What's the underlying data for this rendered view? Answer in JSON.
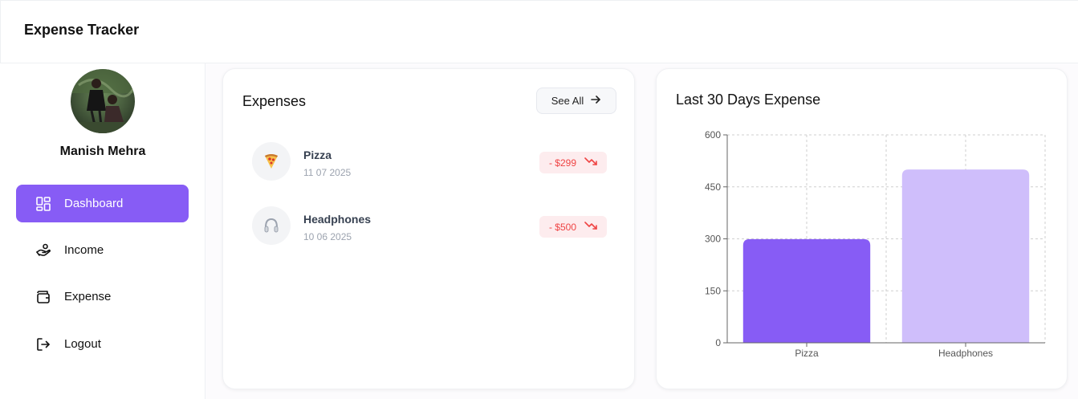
{
  "app": {
    "title": "Expense Tracker"
  },
  "sidebar": {
    "user_name": "Manish Mehra",
    "items": [
      {
        "label": "Dashboard",
        "icon": "dashboard-icon",
        "active": true
      },
      {
        "label": "Income",
        "icon": "income-hand-coins-icon",
        "active": false
      },
      {
        "label": "Expense",
        "icon": "wallet-icon",
        "active": false
      },
      {
        "label": "Logout",
        "icon": "logout-icon",
        "active": false
      }
    ]
  },
  "expenses_card": {
    "title": "Expenses",
    "see_all_label": "See All",
    "items": [
      {
        "name": "Pizza",
        "date": "11 07 2025",
        "amount": "- $299",
        "icon": "pizza-emoji-icon"
      },
      {
        "name": "Headphones",
        "date": "10 06 2025",
        "amount": "- $500",
        "icon": "headphones-emoji-icon"
      }
    ]
  },
  "chart_card": {
    "title": "Last 30 Days Expense"
  },
  "colors": {
    "accent": "#875cf5",
    "accent_light": "#cfbefb",
    "negative": "#ef4444",
    "negative_bg": "#fdecee"
  },
  "chart_data": {
    "type": "bar",
    "categories": [
      "Pizza",
      "Headphones"
    ],
    "values": [
      299,
      500
    ],
    "ylim": [
      0,
      600
    ],
    "yticks": [
      0,
      150,
      300,
      450,
      600
    ],
    "grid": true,
    "bar_colors": [
      "#875cf5",
      "#cfbefb"
    ]
  }
}
